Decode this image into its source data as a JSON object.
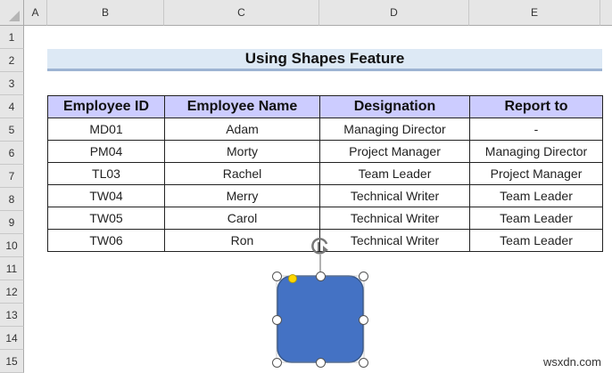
{
  "columns": [
    "A",
    "B",
    "C",
    "D",
    "E"
  ],
  "rows": [
    "1",
    "2",
    "3",
    "4",
    "5",
    "6",
    "7",
    "8",
    "9",
    "10",
    "11",
    "12",
    "13",
    "14",
    "15"
  ],
  "title": "Using Shapes Feature",
  "table": {
    "headers": [
      "Employee ID",
      "Employee Name",
      "Designation",
      "Report to"
    ],
    "rows": [
      [
        "MD01",
        "Adam",
        "Managing Director",
        "-"
      ],
      [
        "PM04",
        "Morty",
        "Project Manager",
        "Managing Director"
      ],
      [
        "TL03",
        "Rachel",
        "Team Leader",
        "Project Manager"
      ],
      [
        "TW04",
        "Merry",
        "Technical Writer",
        "Team Leader"
      ],
      [
        "TW05",
        "Carol",
        "Technical Writer",
        "Team Leader"
      ],
      [
        "TW06",
        "Ron",
        "Technical Writer",
        "Team Leader"
      ]
    ]
  },
  "shape": {
    "type": "rounded-rectangle",
    "fill": "#4472c4"
  },
  "watermark": "wsxdn.com"
}
